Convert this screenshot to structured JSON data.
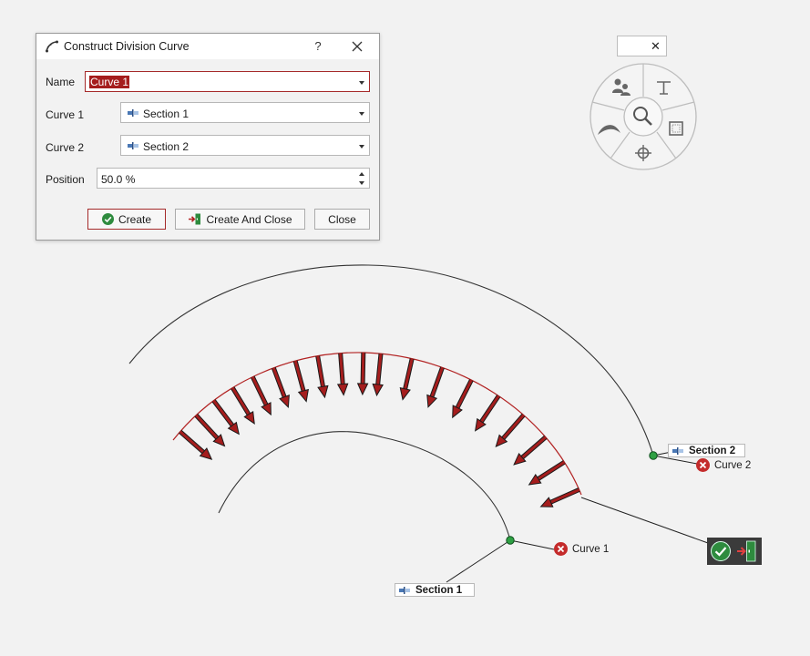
{
  "dialog": {
    "title": "Construct Division Curve",
    "help": "?",
    "name_label": "Name",
    "name_value": "Curve 1",
    "curve1_label": "Curve 1",
    "curve1_value": "Section 1",
    "curve2_label": "Curve 2",
    "curve2_value": "Section 2",
    "position_label": "Position",
    "position_value": "50.0 %",
    "create_label": "Create",
    "create_close_label": "Create And Close",
    "close_label": "Close"
  },
  "viewport": {
    "section1_tag": "Section 1",
    "section2_tag": "Section 2",
    "curve1_label": "Curve 1",
    "curve2_label": "Curve 2"
  },
  "colors": {
    "accent": "#a52a2a",
    "arrow": "#a51d1d",
    "ok_green": "#2e8b3e",
    "close_red": "#c42b2b"
  },
  "icons": [
    "division-curve-icon",
    "close-icon",
    "section-icon",
    "search-icon",
    "check-icon",
    "exit-icon",
    "text-icon",
    "frame-icon",
    "target-icon",
    "wing-icon",
    "people-icon"
  ]
}
